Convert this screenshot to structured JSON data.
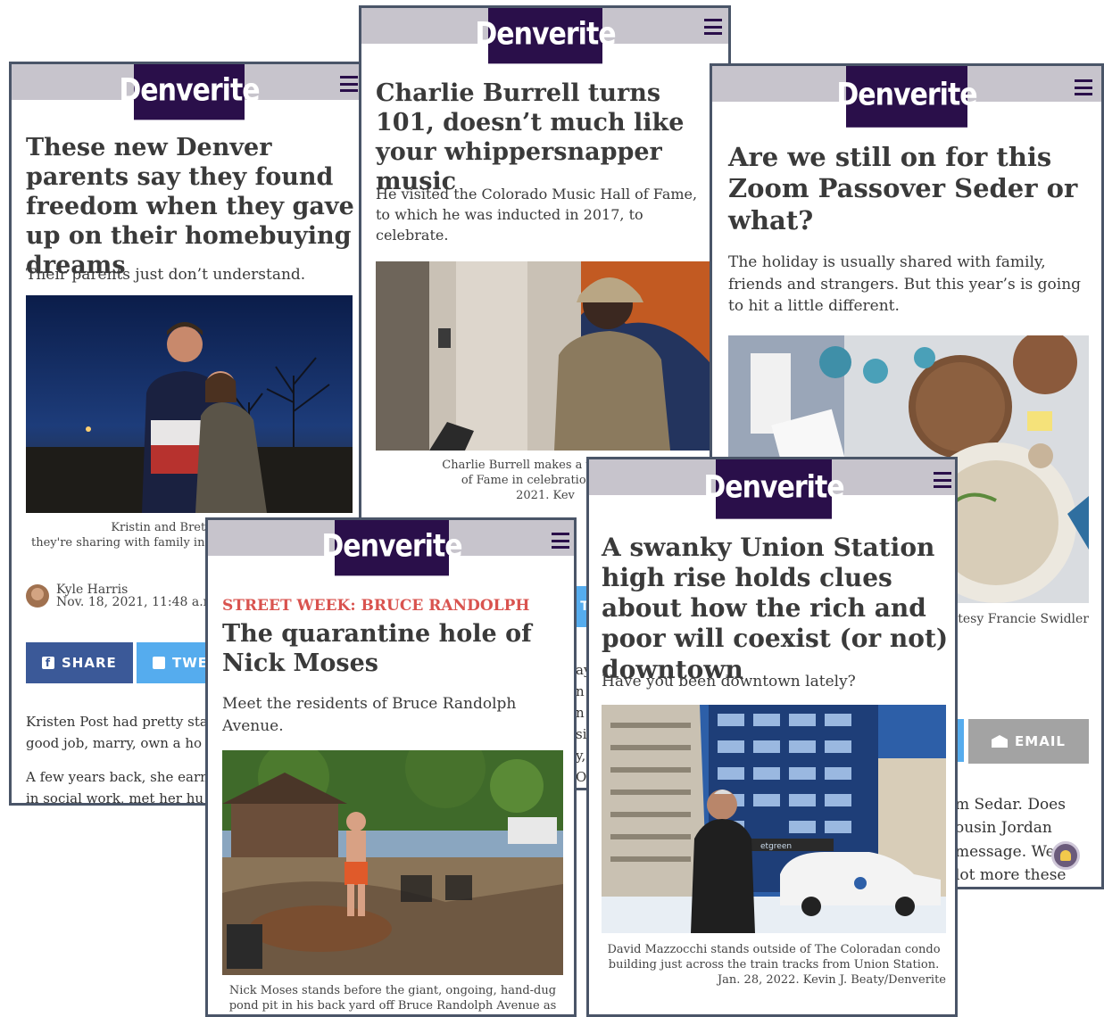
{
  "brand": {
    "logo_text": "Denverite"
  },
  "card1": {
    "headline": "These new Denver parents say they found freedom when they gave up on their homebuying dreams",
    "dek": "Their parents just don’t understand.",
    "caption_line1": "Kristin and Brett Post stan",
    "caption_line2": "they're sharing with family in",
    "author": "Kyle Harris",
    "date": "Nov. 18, 2021, 11:48 a.m",
    "share_label": "SHARE",
    "tweet_label": "TWE",
    "body_p1_line1": "Kristen Post had pretty sta",
    "body_p1_line2": "good job, marry, own a ho",
    "body_p2_line1": "A few years back, she earn",
    "body_p2_line2": "in social work, met her hu"
  },
  "card2": {
    "headline": "Charlie Burrell turns 101, doesn’t much like your whippersnapper music",
    "dek": "He visited the Colorado Music Hall of Fame, to which he was inducted in 2017, to celebrate.",
    "caption_line1": "Charlie Burrell makes a visit to the",
    "caption_line2": "of Fame in celebration of his",
    "caption_line3": "2021.  Kev",
    "peek_col": [
      "ay",
      "n",
      "n",
      "si",
      "y,",
      "O"
    ],
    "peek_btn": "T"
  },
  "card3": {
    "headline": "Are we still on for this Zoom Passover Seder or what?",
    "dek": "The holiday is usually shared with family, friends and strangers. But this year’s is going to hit a little different.",
    "caption": "tesy Francie Swidler",
    "email_label": "EMAIL",
    "body_line1": "m Sedar. Does",
    "body_line2": "ousin Jordan",
    "body_line3": "message. We",
    "body_line4": "lot more these"
  },
  "card4": {
    "kicker": "STREET WEEK: BRUCE RANDOLPH",
    "headline": "The quarantine hole of Nick Moses",
    "dek": "Meet the residents of Bruce Randolph Avenue.",
    "caption_line1": "Nick Moses stands before the giant, ongoing, hand-dug",
    "caption_line2": "pond pit in his back yard off Bruce Randolph Avenue as"
  },
  "card5": {
    "headline": "A swanky Union Station high rise holds clues about how the rich and poor will coexist (or not) downtown",
    "dek": "Have you been downtown lately?",
    "caption_line1": "David Mazzocchi stands outside of The Coloradan condo",
    "caption_line2": "building just across the train tracks from Union Station.",
    "caption_line3": "Jan. 28, 2022.  Kevin J. Beaty/Denverite",
    "photo_sign": "etgreen"
  },
  "colors": {
    "brand": "#2a0f4a",
    "topbar": "#c7c4cc",
    "facebook": "#3b5998",
    "twitter": "#55acee",
    "email": "#a3a3a3",
    "kicker": "#d9534f"
  }
}
